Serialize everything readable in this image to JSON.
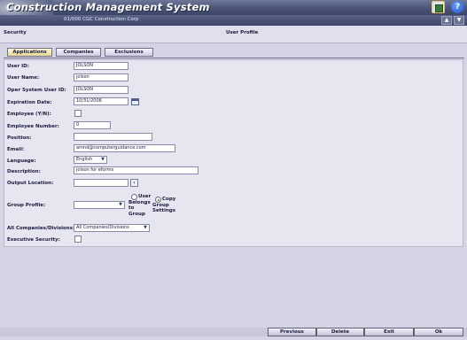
{
  "app": {
    "title": "Construction Management System",
    "company": "01/000  CGC Construction Corp"
  },
  "header": {
    "left": "Security",
    "right": "User Profile"
  },
  "tabs": [
    {
      "label": "Applications",
      "active": true
    },
    {
      "label": "Companies",
      "active": false
    },
    {
      "label": "Exclusions",
      "active": false
    }
  ],
  "form": {
    "user_id": {
      "label": "User ID:",
      "value": "JOLSON"
    },
    "user_name": {
      "label": "User Name:",
      "value": "jolson"
    },
    "oper_user_id": {
      "label": "Oper System User ID:",
      "value": "JOLSON"
    },
    "expiration": {
      "label": "Expiration Date:",
      "value": "10/31/2006"
    },
    "employee_yn": {
      "label": "Employee (Y/N):",
      "checked": false
    },
    "employee_number": {
      "label": "Employee Number:",
      "value": "0"
    },
    "position": {
      "label": "Position:",
      "value": ""
    },
    "email": {
      "label": "Email:",
      "value": "amnd@computerguidance.com"
    },
    "language": {
      "label": "Language:",
      "value": "English"
    },
    "description": {
      "label": "Description:",
      "value": "jolson for eforms"
    },
    "output_location": {
      "label": "Output Location:",
      "value": ""
    },
    "group_profile": {
      "label": "Group Profile:",
      "value": "",
      "option_belongs": "User Belongs to Group",
      "option_copy": "Copy Group Settings",
      "selected": "copy"
    },
    "all_companies": {
      "label": "All Companies/Divisions:",
      "value": "All Companies/Divisions"
    },
    "executive_security": {
      "label": "Executive Security:",
      "checked": false
    }
  },
  "footer": {
    "previous": "Previous",
    "delete": "Delete",
    "exit": "Exit",
    "ok": "Ok"
  },
  "colors": {
    "title_bar": "#4a5478",
    "panel": "#e6e6f0",
    "background": "#d4d4e4"
  }
}
